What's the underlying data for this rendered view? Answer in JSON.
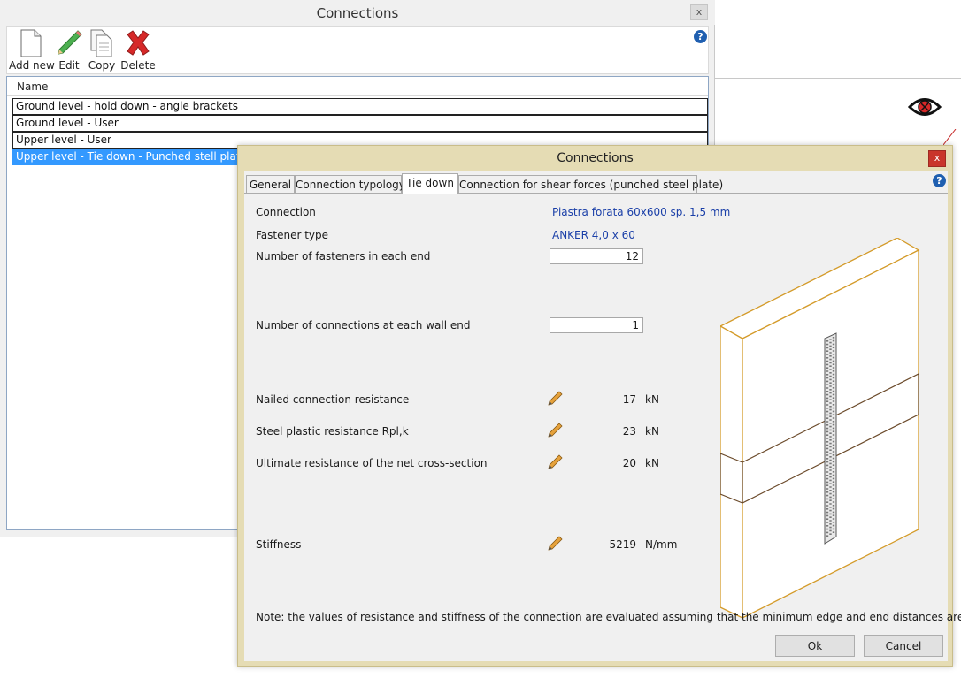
{
  "background_window": {
    "title": "Connections",
    "close_label": "x",
    "help_label": "?",
    "toolbar": [
      {
        "label": "Add new",
        "icon": "new-document-icon"
      },
      {
        "label": "Edit",
        "icon": "pencil-icon"
      },
      {
        "label": "Copy",
        "icon": "copy-icon"
      },
      {
        "label": "Delete",
        "icon": "delete-x-icon"
      }
    ],
    "list": {
      "header": "Name",
      "rows": [
        "Ground level - hold down - angle brackets",
        "Ground level - User",
        "Upper level - User",
        "Upper level - Tie down - Punched stell plate"
      ],
      "selected_index": 3
    }
  },
  "dialog": {
    "title": "Connections",
    "close_label": "x",
    "help_label": "?",
    "tabs": [
      "General",
      "Connection typology",
      "Tie down",
      "Connection for shear forces (punched steel plate)"
    ],
    "active_tab": "Tie down",
    "fields": {
      "connection_label": "Connection",
      "connection_value": "Piastra forata 60x600 sp. 1,5 mm",
      "fastener_label": "Fastener type",
      "fastener_value": "ANKER 4,0 x 60",
      "fasteners_each_end_label": "Number of fasteners in each end",
      "fasteners_each_end_value": "12",
      "connections_each_end_label": "Number of connections at each wall end",
      "connections_each_end_value": "1"
    },
    "results": [
      {
        "label": "Nailed connection resistance",
        "value": "17",
        "unit": "kN"
      },
      {
        "label": "Steel plastic resistance Rpl,k",
        "value": "23",
        "unit": "kN"
      },
      {
        "label": "Ultimate resistance of the net cross-section",
        "value": "20",
        "unit": "kN"
      },
      {
        "label": "Stiffness",
        "value": "5219",
        "unit": "N/mm"
      }
    ],
    "note": "Note: the values of resistance and stiffness of the connection are evaluated assuming that the minimum edge and end distances are fulfilled",
    "ok_label": "Ok",
    "cancel_label": "Cancel"
  },
  "colors": {
    "dialog_frame": "#e5dcb4",
    "selection": "#3399ff",
    "link": "#1a3fa8",
    "close_red": "#c9352b",
    "wall_outline": "#d49b2a"
  }
}
